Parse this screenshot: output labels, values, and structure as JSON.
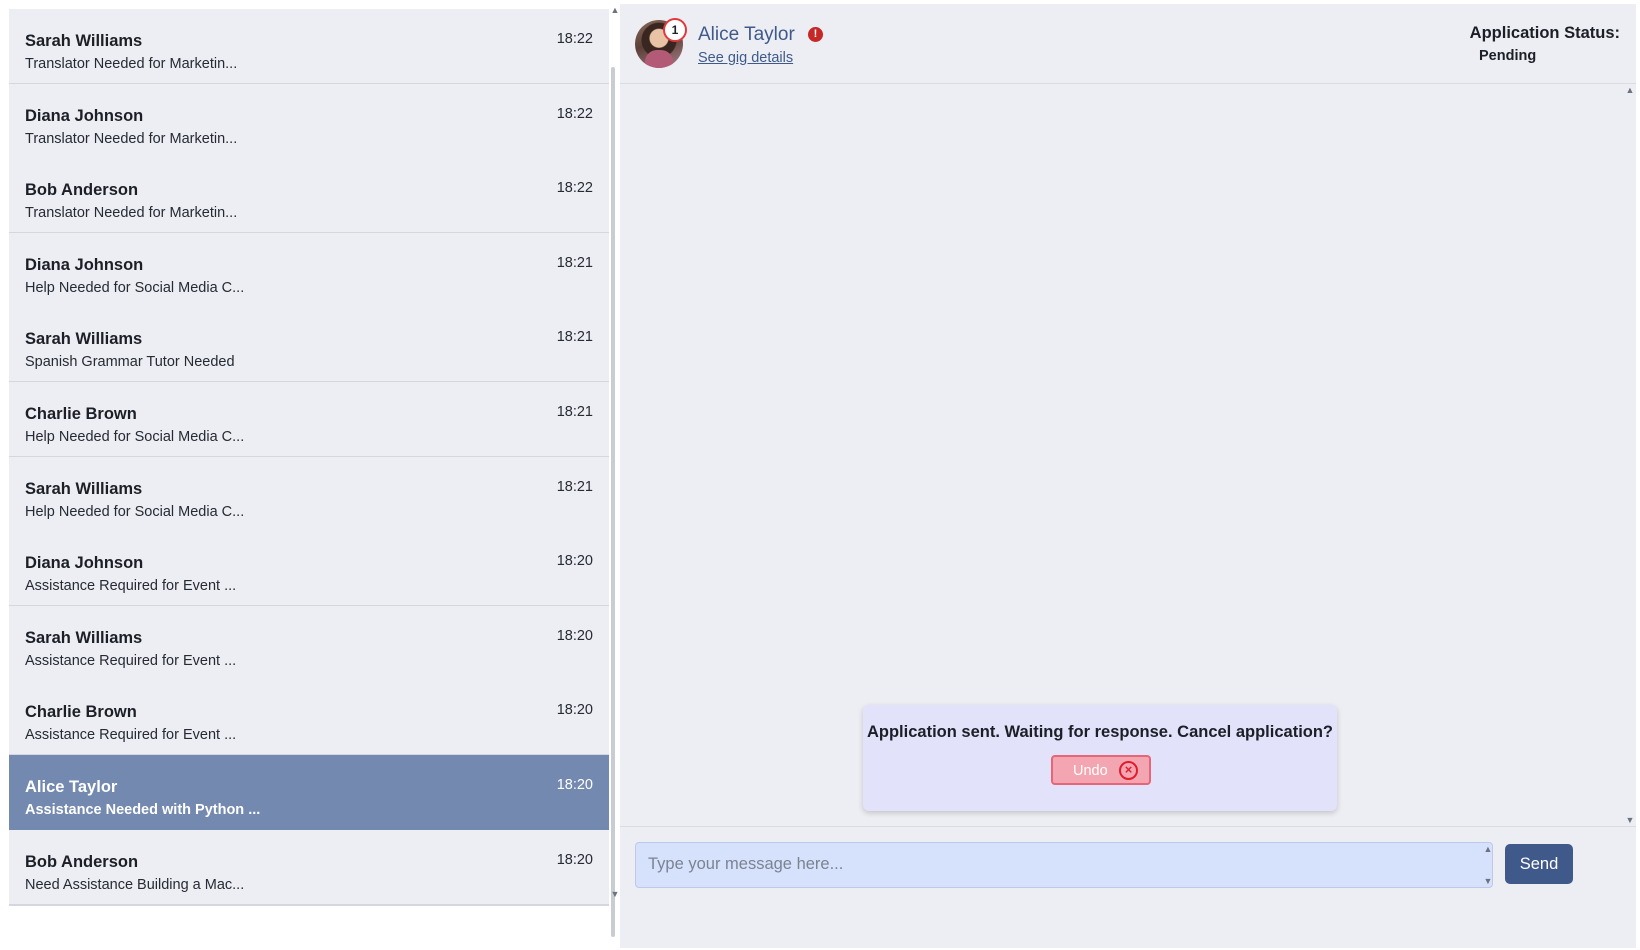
{
  "conversations": [
    {
      "name": "Sarah Williams",
      "subtitle": "Translator Needed for Marketin...",
      "time": "18:22",
      "active": false
    },
    {
      "name": "Diana Johnson",
      "subtitle": "Translator Needed for Marketin...",
      "time": "18:22",
      "active": false
    },
    {
      "name": "Bob Anderson",
      "subtitle": "Translator Needed for Marketin...",
      "time": "18:22",
      "active": false
    },
    {
      "name": "Diana Johnson",
      "subtitle": "Help Needed for Social Media C...",
      "time": "18:21",
      "active": false
    },
    {
      "name": "Sarah Williams",
      "subtitle": "Spanish Grammar Tutor Needed",
      "time": "18:21",
      "active": false
    },
    {
      "name": "Charlie Brown",
      "subtitle": "Help Needed for Social Media C...",
      "time": "18:21",
      "active": false
    },
    {
      "name": "Sarah Williams",
      "subtitle": "Help Needed for Social Media C...",
      "time": "18:21",
      "active": false
    },
    {
      "name": "Diana Johnson",
      "subtitle": "Assistance Required for Event ...",
      "time": "18:20",
      "active": false
    },
    {
      "name": "Sarah Williams",
      "subtitle": "Assistance Required for Event ...",
      "time": "18:20",
      "active": false
    },
    {
      "name": "Charlie Brown",
      "subtitle": "Assistance Required for Event ...",
      "time": "18:20",
      "active": false
    },
    {
      "name": "Alice Taylor",
      "subtitle": "Assistance Needed with Python ...",
      "time": "18:20",
      "active": true
    },
    {
      "name": "Bob Anderson",
      "subtitle": "Need Assistance Building a Mac...",
      "time": "18:20",
      "active": false
    }
  ],
  "chat": {
    "contact_name": "Alice Taylor",
    "notification_count": "1",
    "alert_glyph": "!",
    "gig_link": "See gig details",
    "status_label": "Application Status:",
    "status_value": "Pending"
  },
  "toast": {
    "message": "Application sent. Waiting for response. Cancel application?",
    "undo_label": "Undo",
    "undo_icon": "×"
  },
  "composer": {
    "placeholder": "Type your message here...",
    "value": "",
    "send_label": "Send"
  },
  "colors": {
    "accent": "#3f5a8a",
    "active_item": "#7389b0",
    "panel_bg": "#eceef3",
    "toast_bg": "#e3e2fb",
    "undo_bg": "#f3a6b2",
    "alert": "#c62828"
  },
  "icons": {
    "scroll_up": "chevron-up-icon",
    "scroll_down": "chevron-down-icon",
    "alert": "alert-circle-icon",
    "undo": "close-circle-icon"
  }
}
